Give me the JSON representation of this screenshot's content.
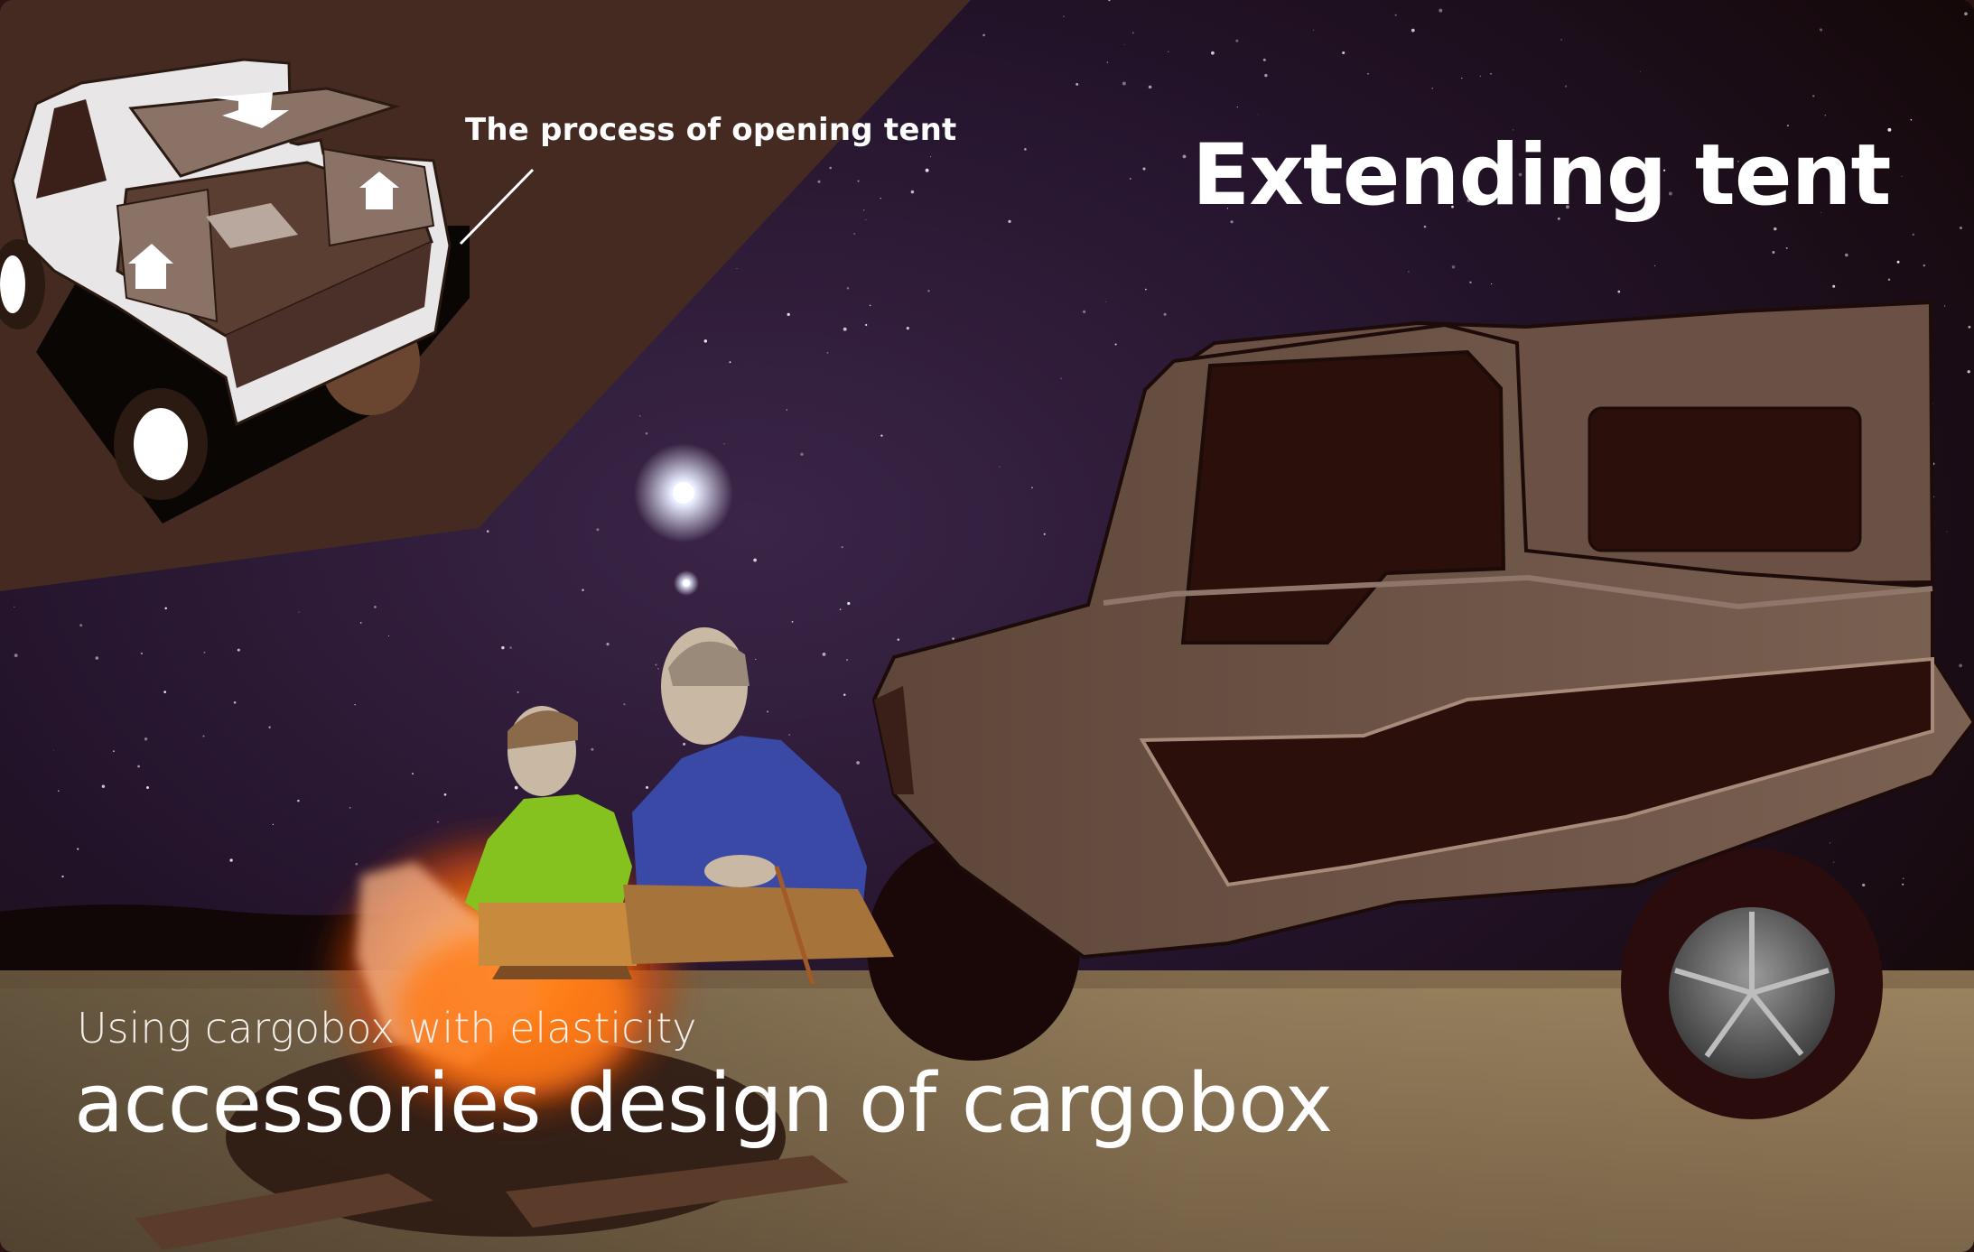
{
  "annotation": {
    "process_label": "The process of opening tent"
  },
  "headline": "Extending tent",
  "caption": {
    "subtitle": "Using cargobox with elasticity",
    "title": "accessories design of cargobox"
  },
  "colors": {
    "night_sky": "#1e0f1f",
    "inset_panel": "#442a20",
    "vehicle_body": "#6e5548",
    "vehicle_dark": "#2a0f0a",
    "ground": "#8d7654",
    "fire": "#ff7a18",
    "boy_jacket": "#86c21f",
    "man_jacket": "#3a49a6"
  },
  "icons": {
    "inset": "vehicle-diagram-icon",
    "arrows": "arrow-icon"
  }
}
